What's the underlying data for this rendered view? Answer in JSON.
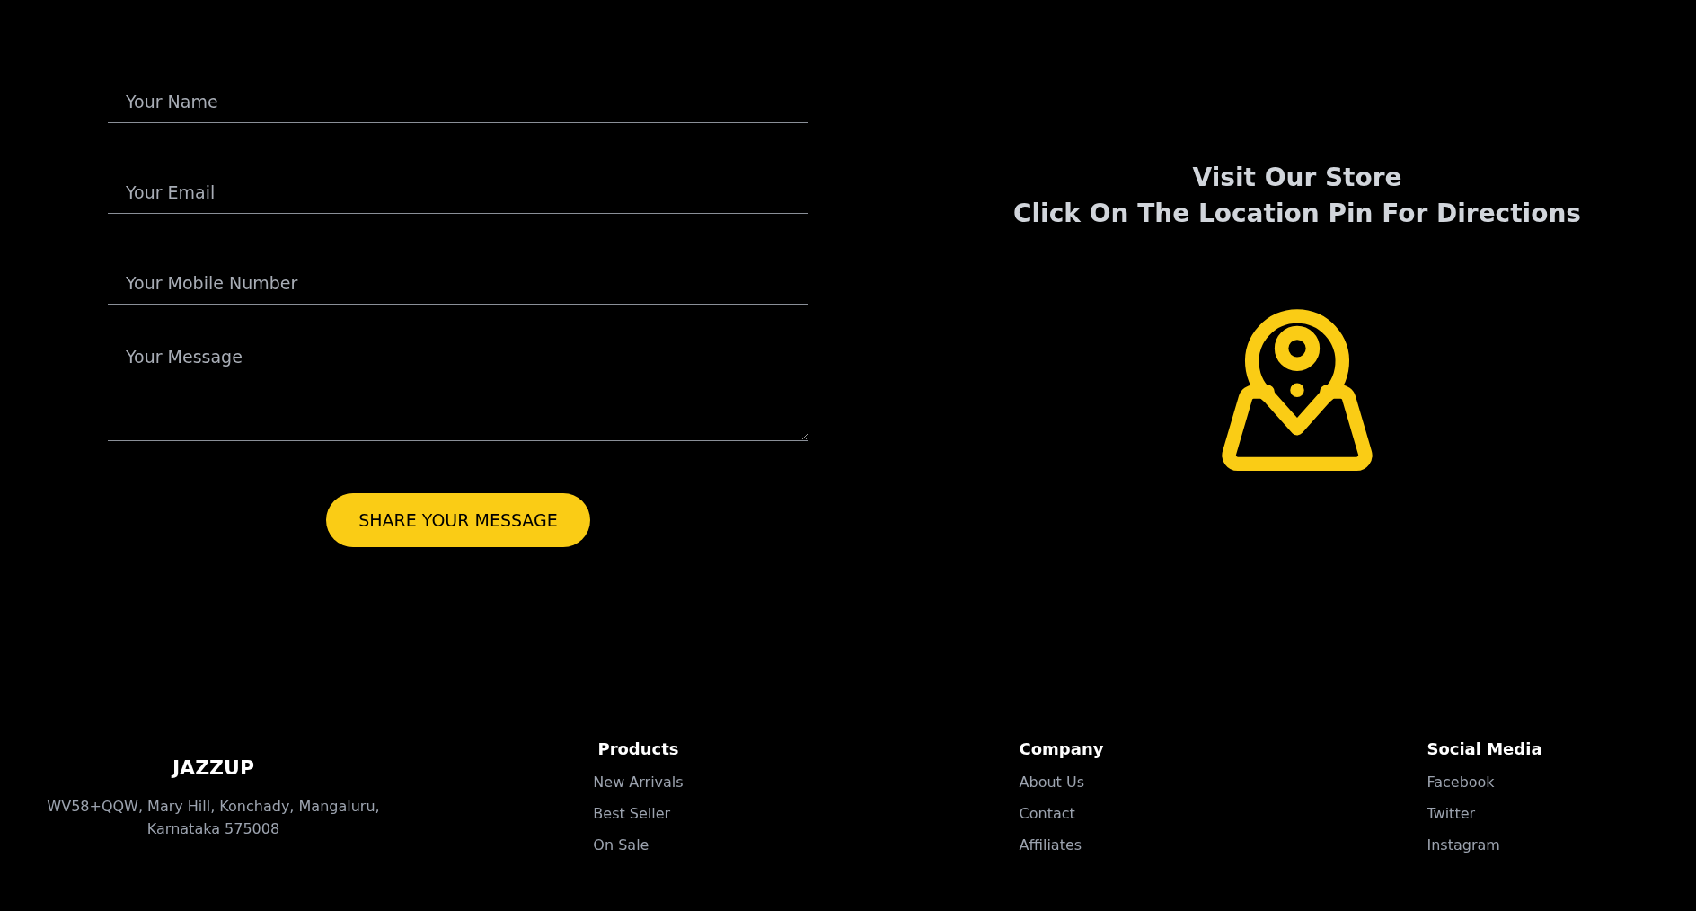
{
  "form": {
    "fields": [
      {
        "kind": "input",
        "placeholder": "Your Name"
      },
      {
        "kind": "input",
        "placeholder": "Your Email"
      },
      {
        "kind": "input",
        "placeholder": "Your Mobile Number"
      },
      {
        "kind": "textarea",
        "placeholder": "Your Message"
      }
    ],
    "submit": "SHARE YOUR MESSAGE"
  },
  "store": {
    "title": "Visit Our Store",
    "subtitle": "Click On The Location Pin For Directions"
  },
  "footer": {
    "brand": "JAZZUP",
    "address": "WV58+QQW, Mary Hill, Konchady, Mangaluru, Karnataka 575008",
    "columns": [
      {
        "heading": "Products",
        "links": [
          "New Arrivals",
          "Best Seller",
          "On Sale"
        ]
      },
      {
        "heading": "Company",
        "links": [
          "About Us",
          "Contact",
          "Affiliates"
        ]
      },
      {
        "heading": "Social Media",
        "links": [
          "Facebook",
          "Twitter",
          "Instagram"
        ]
      }
    ]
  }
}
